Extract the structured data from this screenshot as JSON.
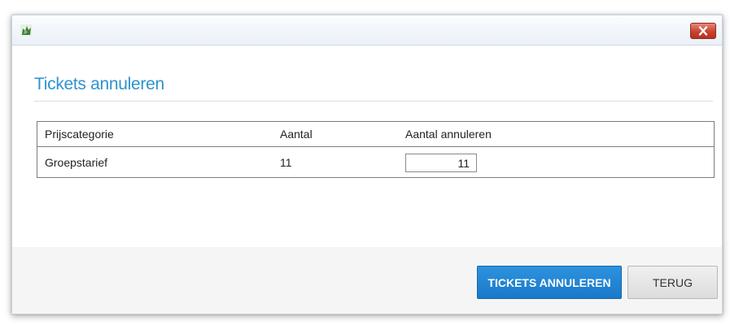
{
  "window": {
    "app_icon": "leaf-app-icon",
    "close_icon": "close-x-icon",
    "close_label": "×"
  },
  "dialog": {
    "title": "Tickets annuleren"
  },
  "table": {
    "headers": [
      "Prijscategorie",
      "Aantal",
      "Aantal annuleren"
    ],
    "rows": [
      {
        "category": "Groepstarief",
        "count": "11",
        "cancel_count": "11"
      }
    ]
  },
  "buttons": {
    "confirm_label": "TICKETS ANNULEREN",
    "back_label": "TERUG"
  },
  "colors": {
    "title": "#2f93cf",
    "primary_button": "#1a79c8",
    "close_button": "#c9422f"
  }
}
